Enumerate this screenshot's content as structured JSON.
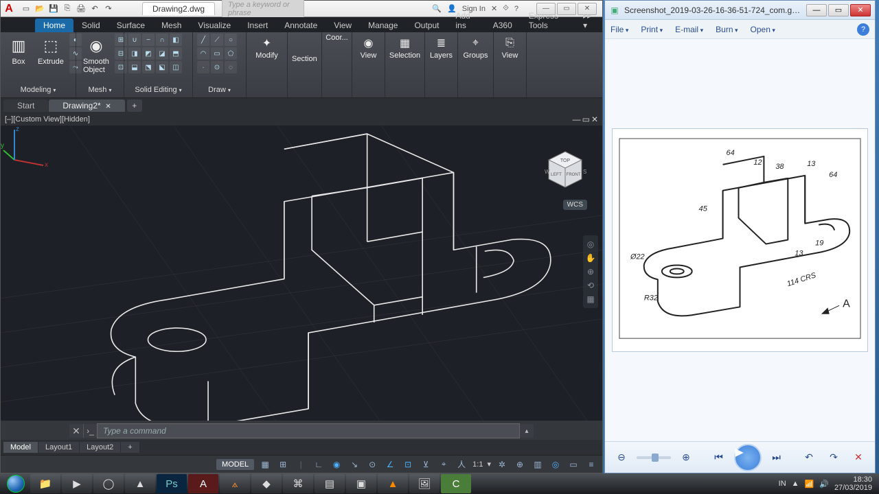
{
  "acad": {
    "titlebar": {
      "document": "Drawing2.dwg",
      "searchPlaceholder": "Type a keyword or phrase",
      "signIn": "Sign In"
    },
    "ribbonTabs": [
      "Home",
      "Solid",
      "Surface",
      "Mesh",
      "Visualize",
      "Insert",
      "Annotate",
      "View",
      "Manage",
      "Output",
      "Add-ins",
      "A360",
      "Express Tools"
    ],
    "activeRibbonTab": "Home",
    "panels": {
      "modeling": {
        "label": "Modeling",
        "box": "Box",
        "extrude": "Extrude",
        "smooth": "Smooth\nObject"
      },
      "mesh": {
        "label": "Mesh"
      },
      "solidEditing": {
        "label": "Solid Editing"
      },
      "draw": {
        "label": "Draw"
      },
      "modify": {
        "label": "Modify"
      },
      "section": {
        "label": "Section"
      },
      "coordinates": {
        "label": "Coor..."
      },
      "view": {
        "label": "View"
      },
      "selection": {
        "label": "Selection"
      },
      "layers": {
        "label": "Layers"
      },
      "groups": {
        "label": "Groups"
      },
      "view2": {
        "label": "View"
      }
    },
    "docTabs": {
      "start": "Start",
      "drawing": "Drawing2*"
    },
    "viewLabel": "[–][Custom View][Hidden]",
    "wcs": "WCS",
    "commandPlaceholder": "Type a command",
    "layoutTabs": [
      "Model",
      "Layout1",
      "Layout2"
    ],
    "statusbar": {
      "model": "MODEL",
      "scale": "1:1"
    }
  },
  "viewer": {
    "title": "Screenshot_2019-03-26-16-36-51-724_com.google....",
    "menu": [
      "File",
      "Print",
      "E-mail",
      "Burn",
      "Open"
    ],
    "dimensions": {
      "d1": "64",
      "d2": "12",
      "d3": "38",
      "d4": "13",
      "d5": "64",
      "phi": "Ø22",
      "h": "45",
      "r": "R32",
      "len": "114 CRS",
      "t1": "13",
      "t2": "19",
      "arrow": "A"
    }
  },
  "tray": {
    "lang": "IN",
    "time": "18:30",
    "date": "27/03/2019"
  }
}
